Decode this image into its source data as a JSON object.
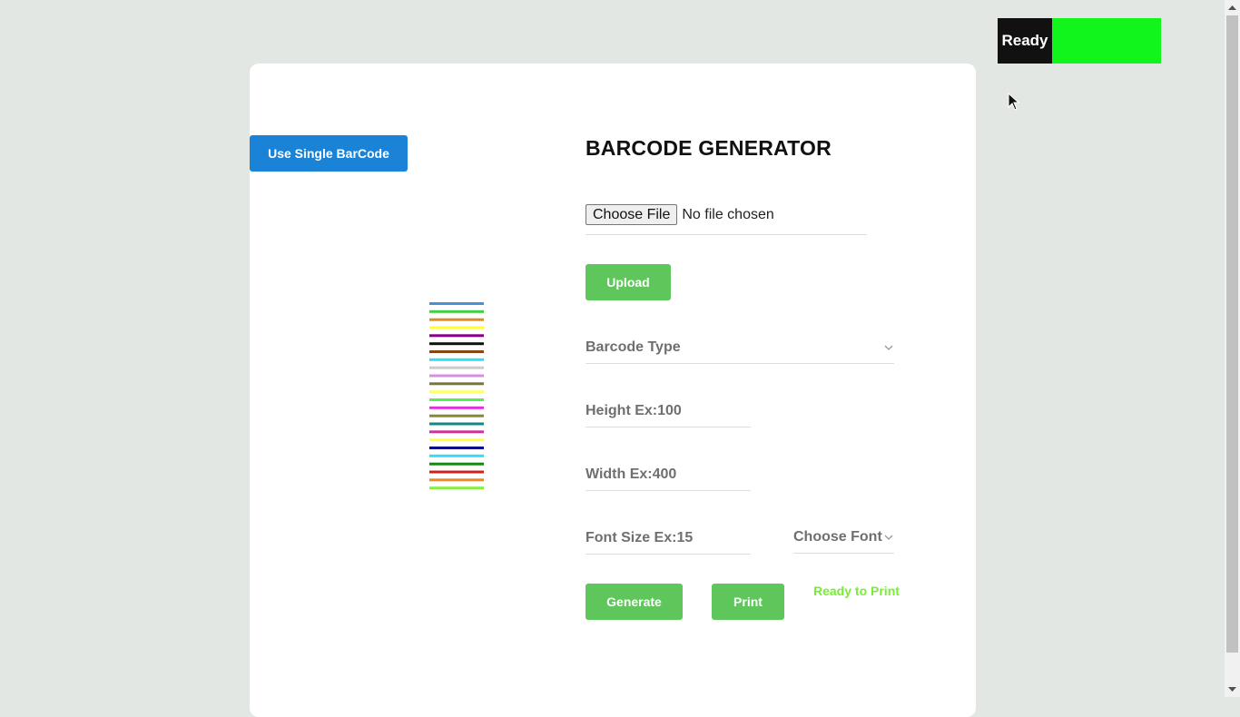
{
  "status": {
    "label": "Ready",
    "color": "#12f51c"
  },
  "sidebar": {
    "single_barcode_label": "Use Single BarCode"
  },
  "main": {
    "title": "BARCODE GENERATOR",
    "file": {
      "button_label": "Choose File",
      "status_text": "No file chosen"
    },
    "upload_label": "Upload",
    "barcode_type": {
      "placeholder": "Barcode Type"
    },
    "height": {
      "placeholder": "Height Ex:100"
    },
    "width": {
      "placeholder": "Width Ex:400"
    },
    "font_size": {
      "placeholder": "Font Size Ex:15"
    },
    "font": {
      "placeholder": "Choose Font"
    },
    "generate_label": "Generate",
    "print_label": "Print",
    "print_status": "Ready to Print"
  },
  "preview": {
    "bar_colors": [
      "#4a90d9",
      "#44cc44",
      "#e08a20",
      "#ffff33",
      "#880088",
      "#111111",
      "#884411",
      "#33ddee",
      "#cccccc",
      "#d58ee0",
      "#777733",
      "#ffff66",
      "#55ee55",
      "#dd33dd",
      "#888833",
      "#118888",
      "#cc3399",
      "#ffff44",
      "#000088",
      "#33ddee",
      "#118811",
      "#cc2222",
      "#ee8822",
      "#88ee44"
    ]
  },
  "colors": {
    "accent_blue": "#1a83d7",
    "accent_green": "#5ec65a",
    "ready_text": "#77ee33"
  }
}
